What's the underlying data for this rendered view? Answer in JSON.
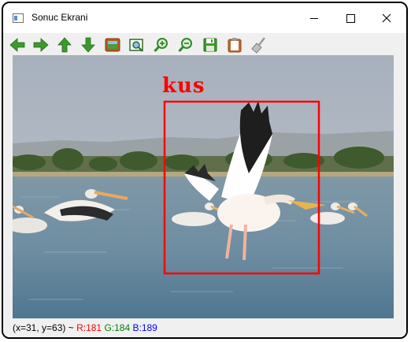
{
  "window": {
    "title": "Sonuc Ekrani"
  },
  "toolbar": {
    "icons": [
      "arrow-left-icon",
      "arrow-right-icon",
      "arrow-up-icon",
      "arrow-down-icon",
      "image-icon",
      "zoom-region-icon",
      "zoom-in-icon",
      "zoom-out-icon",
      "save-icon",
      "copy-to-clipboard-icon",
      "clear-brush-icon"
    ]
  },
  "detection": {
    "label": "kus",
    "color": "#ff0000"
  },
  "status": {
    "coords": "(x=31, y=63)",
    "separator": "~",
    "r": "R:181",
    "g": "G:184",
    "b": "B:189",
    "r_color": "#ff0000",
    "g_color": "#008000",
    "b_color": "#0000ff"
  },
  "colors": {
    "icon_green": "#3a9b2a",
    "frame": "#000000"
  }
}
